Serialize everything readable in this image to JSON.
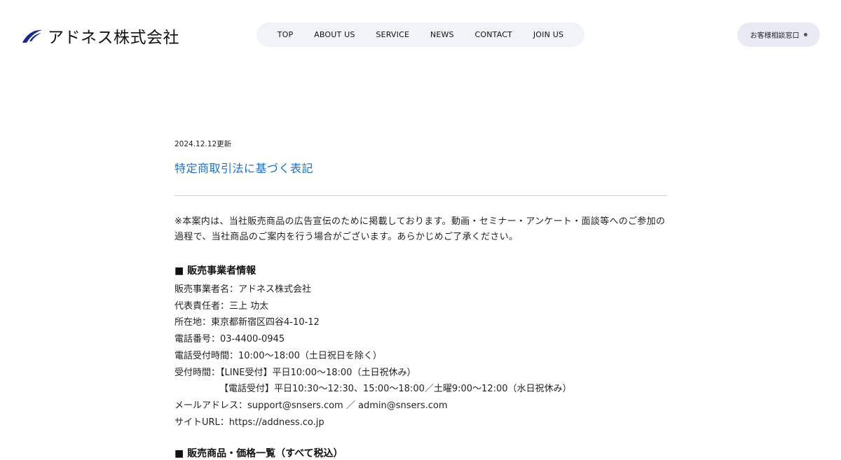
{
  "header": {
    "logo_text": "アドネス株式会社",
    "brand_color": "#1b2a8c",
    "nav": [
      {
        "label": "TOP"
      },
      {
        "label": "ABOUT US"
      },
      {
        "label": "SERVICE"
      },
      {
        "label": "NEWS"
      },
      {
        "label": "CONTACT"
      },
      {
        "label": "JOIN US"
      }
    ],
    "consult_label": "お客様相談窓口"
  },
  "page": {
    "date": "2024.12.12更新",
    "title": "特定商取引法に基づく表記",
    "intro_1": "※本案内は、当社販売商品の広告宣伝のために掲載しております。動画・セミナー・アンケート・面談等へのご参加の",
    "intro_2": "過程で、当社商品のご案内を行う場合がございます。あらかじめご了承ください。",
    "section1_heading": "■ 販売事業者情報",
    "info_lines": [
      "販売事業者名：アドネス株式会社",
      "代表責任者：三上 功太",
      "所在地：東京都新宿区四谷4-10-12",
      "電話番号：03-4400-0945",
      "電話受付時間：10:00～18:00（土日祝日を除く）",
      "受付時間：【LINE受付】平日10:00～18:00（土日祝休み）",
      "【電話受付】平日10:30～12:30、15:00～18:00／土曜9:00～12:00（水日祝休み）",
      "メールアドレス：support@snsers.com ／ admin@snsers.com",
      "サイトURL：https://addness.co.jp"
    ],
    "section2_heading": "■ 販売商品・価格一覧（すべて税込）"
  }
}
